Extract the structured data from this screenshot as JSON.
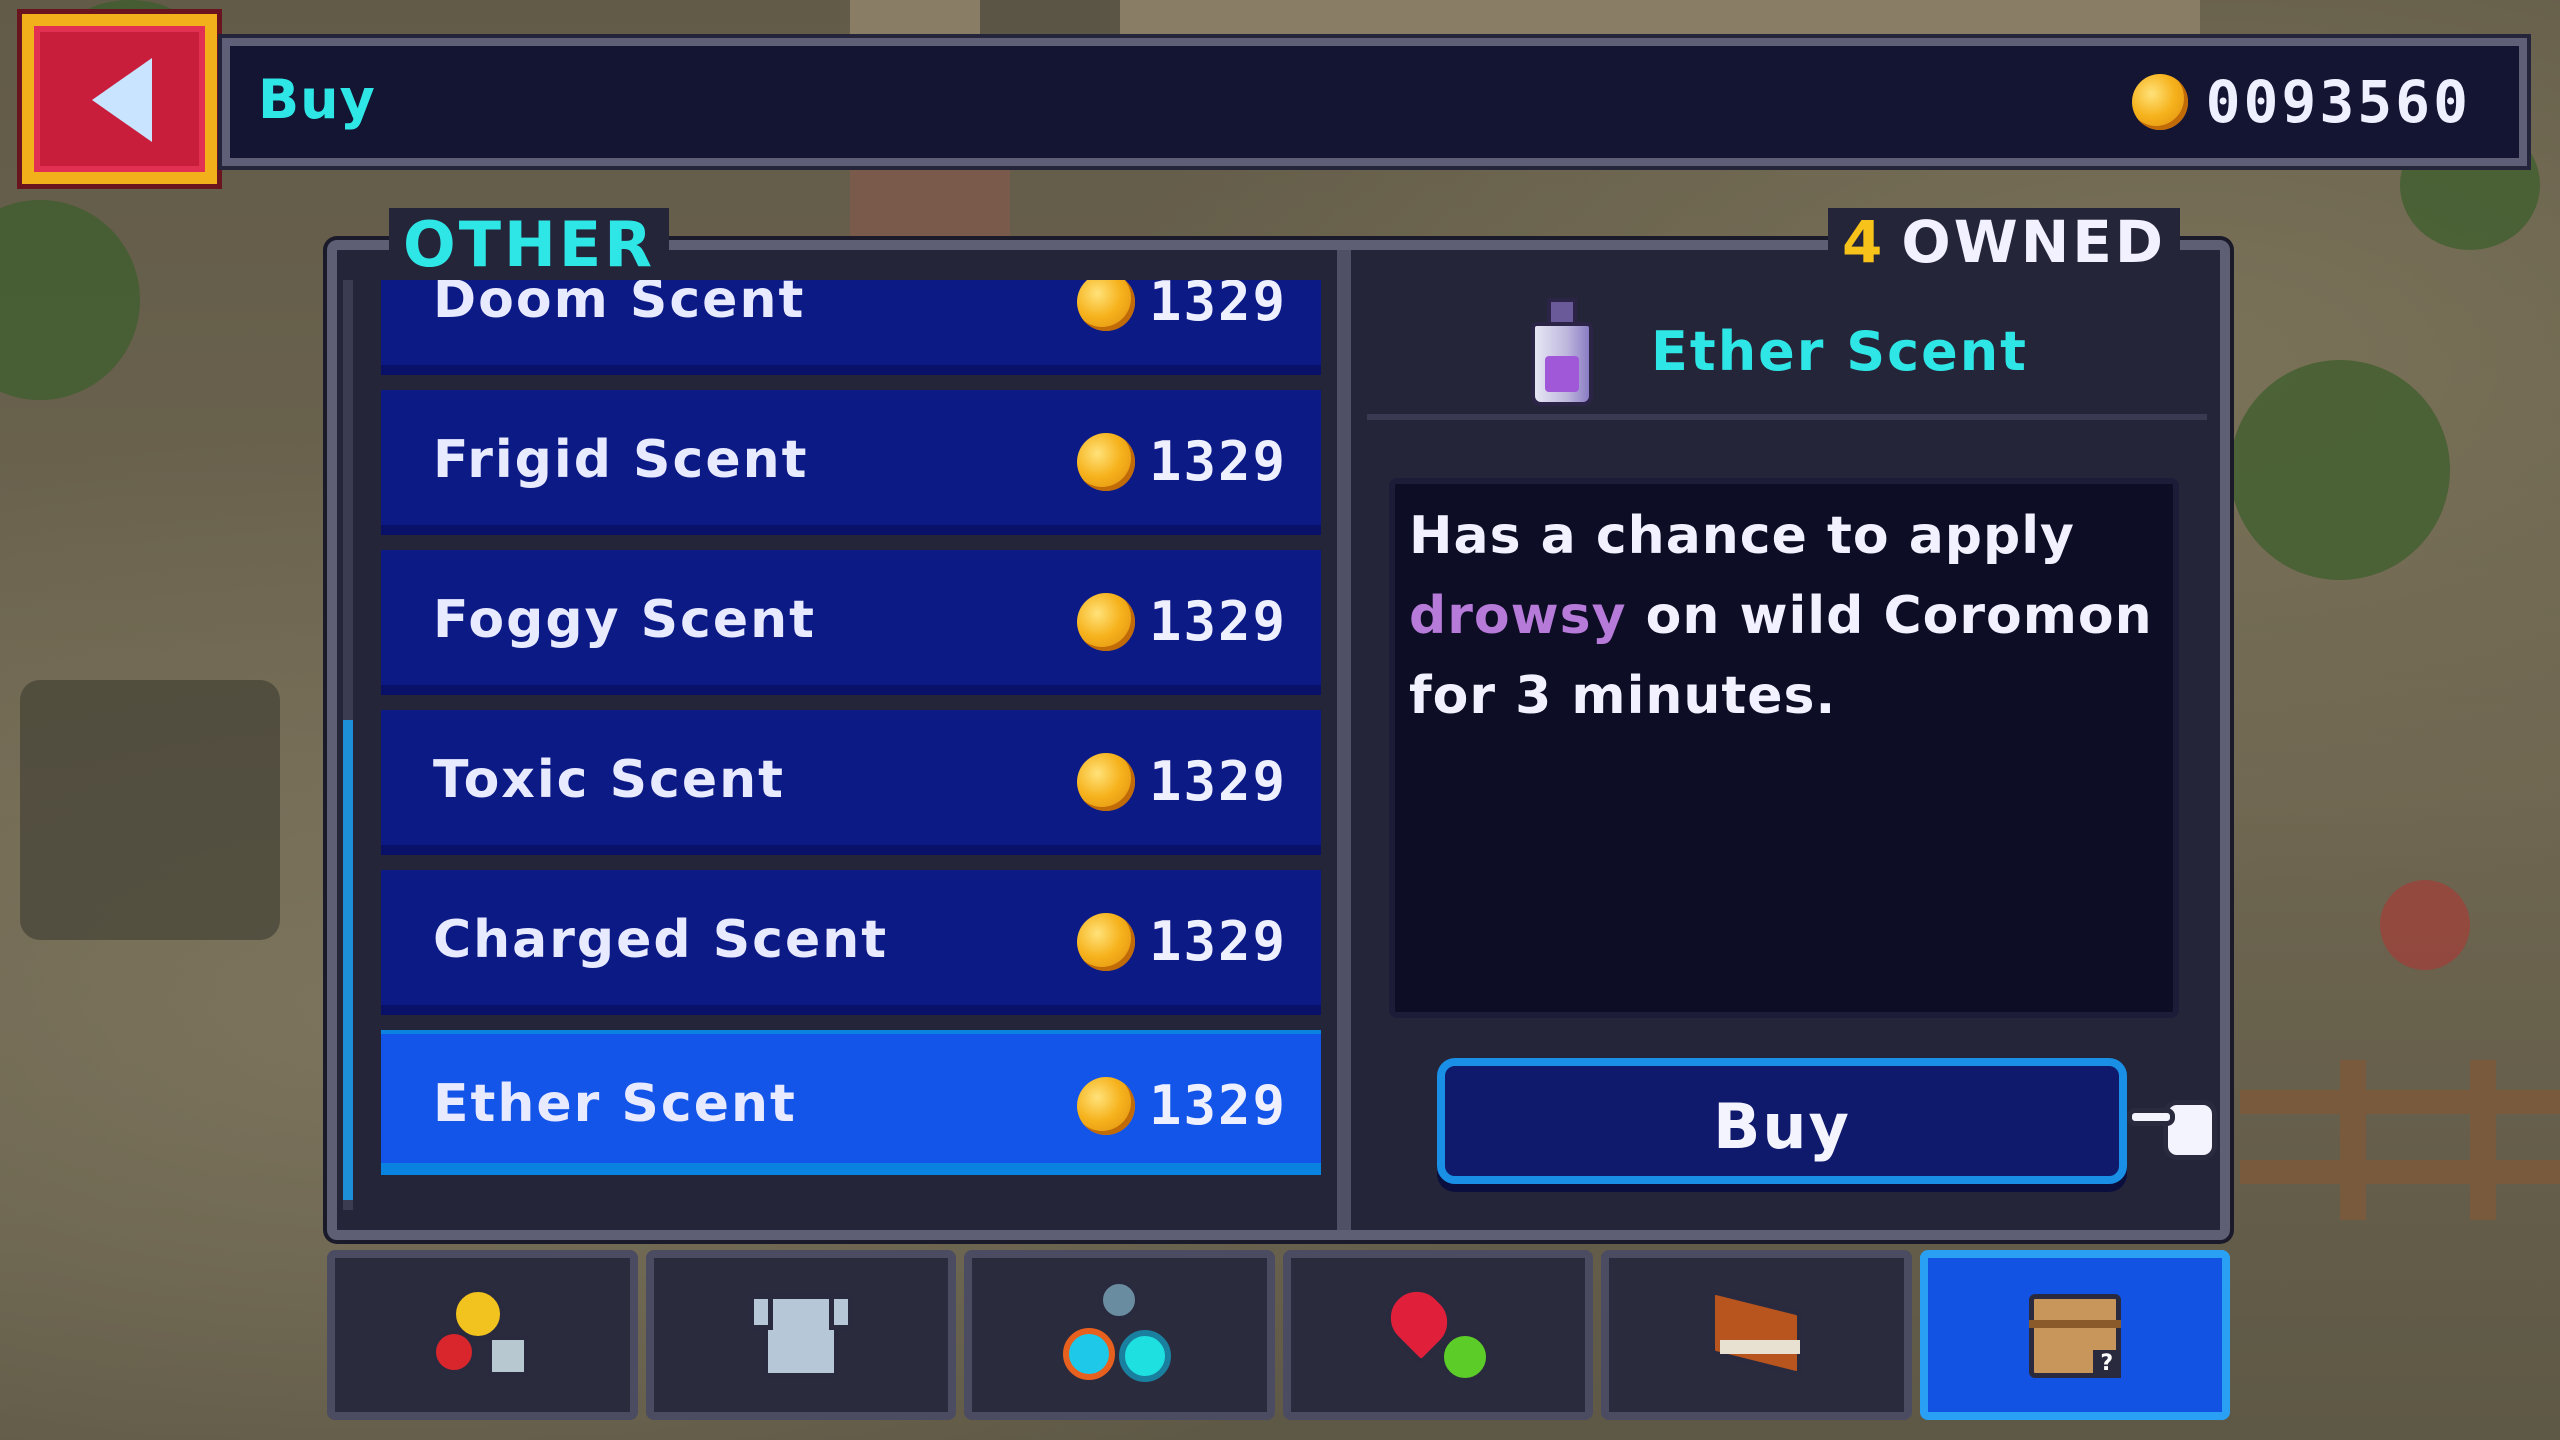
{
  "top_bar": {
    "back_icon": "back-arrow-icon",
    "title": "Buy",
    "money": "0093560",
    "money_icon": "gold-coin-icon"
  },
  "panel": {
    "category": "OTHER",
    "owned_count": "4",
    "owned_label": "OWNED"
  },
  "items": [
    {
      "name": "Doom Scent",
      "price": "1329"
    },
    {
      "name": "Frigid Scent",
      "price": "1329"
    },
    {
      "name": "Foggy Scent",
      "price": "1329"
    },
    {
      "name": "Toxic Scent",
      "price": "1329"
    },
    {
      "name": "Charged Scent",
      "price": "1329"
    },
    {
      "name": "Ether Scent",
      "price": "1329",
      "selected": true
    }
  ],
  "detail": {
    "icon": "ether-scent-bottle-icon",
    "name": "Ether Scent",
    "description_pre": "Has a chance to apply",
    "description_status": "drowsy",
    "description_post": "on wild Coromon for 3 minutes.",
    "buy_label": "Buy",
    "confirm_icon": "hand-pointer-icon"
  },
  "tabs": [
    {
      "icon": "fruit-and-candy-icon"
    },
    {
      "icon": "shirt-icon"
    },
    {
      "icon": "gems-icon"
    },
    {
      "icon": "heart-and-apple-icon"
    },
    {
      "icon": "book-icon"
    },
    {
      "icon": "mystery-box-icon",
      "active": true
    }
  ],
  "colors": {
    "accent_cyan": "#2ee6e6",
    "list_blue": "#0c1a86",
    "selected_blue": "#1355e8",
    "coin_gold": "#f6b21c",
    "status_purple": "#b67ad8",
    "back_red": "#c81e3c"
  }
}
